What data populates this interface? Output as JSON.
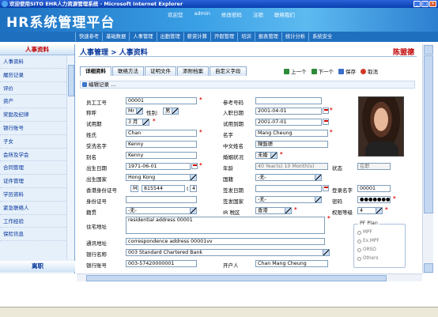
{
  "window": {
    "title": "欢迎使用SITO EHR人力资源管理系统 - Microsoft Internet Explorer"
  },
  "banner": {
    "logo": "HR系统管理平台",
    "welcome": "欢迎您",
    "user": "admin",
    "links": [
      "修改密码",
      "注销",
      "联络我们"
    ]
  },
  "nav": [
    "快速参考",
    "基础数据",
    "人事管理",
    "出勤管理",
    "薪资计算",
    "开假管理",
    "培训",
    "报表管理",
    "统计分析",
    "系统安全"
  ],
  "sidebar": {
    "title": "人事资料",
    "items": [
      "人事资料",
      "履历记录",
      "评价",
      "资产",
      "奖励及纪律",
      "银行账号",
      "子女",
      "会所及学会",
      "合同管理",
      "证件管理",
      "学历资料",
      "紧急联络人",
      "工作经验",
      "保险讯息"
    ],
    "footer": "离职"
  },
  "header": {
    "breadcrumb": "人事管理 > 人事资料",
    "user_name": "陈盟德"
  },
  "tabs": [
    "详细资料",
    "联络方法",
    "证明文件",
    "添附档案",
    "自定义字段"
  ],
  "actions": {
    "prev": "上一个",
    "next": "下一个",
    "save": "保存",
    "cancel": "取消"
  },
  "section": "编辑记录 ...",
  "form": {
    "emp_no": {
      "label": "员工工号",
      "value": "00001"
    },
    "ref_no": {
      "label": "参考号码",
      "value": ""
    },
    "title": {
      "label": "称呼",
      "value": "Mr",
      "gender_label": "性别:",
      "gender": "男"
    },
    "hire_date": {
      "label": "入职日期",
      "value": "2001-04-01"
    },
    "probation": {
      "label": "试用期",
      "value": "3 月"
    },
    "probation_end": {
      "label": "试用到期",
      "value": "2001-07-01"
    },
    "surname": {
      "label": "姓氏",
      "value": "Chan"
    },
    "given": {
      "label": "名字",
      "value": "Mang Cheung"
    },
    "en_name": {
      "label": "受洗名字",
      "value": "Kenny"
    },
    "cn_name": {
      "label": "中文姓名",
      "value": "陳盟德"
    },
    "alias": {
      "label": "别名",
      "value": "Kenny"
    },
    "marital": {
      "label": "婚姻状况",
      "value": "未婚"
    },
    "dob": {
      "label": "出生日期",
      "value": "1971-06-01"
    },
    "age": {
      "label": "年龄",
      "value": "40 Year(s) 10 Month(s)"
    },
    "status": {
      "label": "状态",
      "value": "在职"
    },
    "birth_country": {
      "label": "出生国家",
      "value": "Hong Kong"
    },
    "nationality": {
      "label": "国籍",
      "value": "-无-"
    },
    "hkid": {
      "label": "香港身份证号",
      "prefix": "M",
      "number": "815544",
      "check": "4"
    },
    "issue_date": {
      "label": "签发日期",
      "value": ""
    },
    "login": {
      "label": "登录名字",
      "value": "00001"
    },
    "id_no": {
      "label": "身份证号",
      "value": ""
    },
    "issue_country": {
      "label": "签发国家",
      "value": "-无-"
    },
    "password": {
      "label": "密码",
      "value": "●●●●●●●●"
    },
    "native": {
      "label": "籍贯",
      "value": "-无-"
    },
    "tax_area": {
      "label": "IR 税区",
      "value": "香港"
    },
    "perm_level": {
      "label": "权限等级",
      "value": "4"
    },
    "res_addr": {
      "label": "住宅地址",
      "value": "residential address 00001"
    },
    "corr_addr": {
      "label": "通讯地址",
      "value": "correspondence address 00001vv"
    },
    "bank_name": {
      "label": "银行名称",
      "value": "003 Standard Chartered Bank"
    },
    "bank_acc": {
      "label": "银行账号",
      "value": "003-57420000001"
    },
    "acc_holder": {
      "label": "开户人",
      "value": "Chan  Mang Cheung"
    }
  },
  "pf_plan": {
    "title": "PF Plan",
    "options": [
      "MPF",
      "Ex.MPF",
      "ORSO",
      "Others"
    ]
  }
}
